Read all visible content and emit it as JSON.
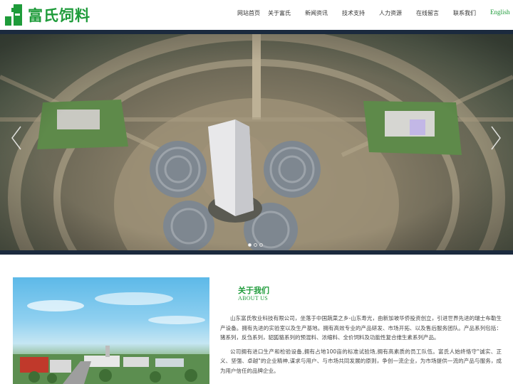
{
  "header": {
    "logo_text": "富氏饲料",
    "brand_color": "#1e9b3a",
    "nav": [
      {
        "label": "网站首页"
      },
      {
        "label": "关于富氏"
      },
      {
        "label": "新闻资讯"
      },
      {
        "label": "技术支持"
      },
      {
        "label": "人力资源"
      },
      {
        "label": "在线留言"
      },
      {
        "label": "联系我们"
      }
    ],
    "lang_label": "English"
  },
  "banner": {
    "prev_icon": "chevron-left-icon",
    "next_icon": "chevron-right-icon",
    "slide_count": 3,
    "active_slide": 1
  },
  "about": {
    "title": "关于我们",
    "subtitle": "ABOUT US",
    "paragraphs": [
      "山东富氏牧业科技有限公司，坐落于中国蔬菜之乡-山东寿光，由新加坡华侨投资创立，引进世界先进的瑞士布勒生产设备。拥有先进的实验室以及生产基地。拥有高效专业的产品研发、市场开拓、以及售后服务团队。产品系列包括：猪系列，反刍系列，貂狐貉系列的预混料、浓缩料、全价饲料及功能性复合维生素系列产品。",
      "公司拥有进口生产和检验设备,拥有占地100亩的标准试验场,拥有高素质的员工队伍。富氏人始终恪守\"诚实、正义、坚强、卓越\"的企业精神,谋求与用户、与市场共同发展的原则，争创一流企业，为市场提供一流的产品与服务，成为用户信任的品牌企业。"
    ]
  }
}
